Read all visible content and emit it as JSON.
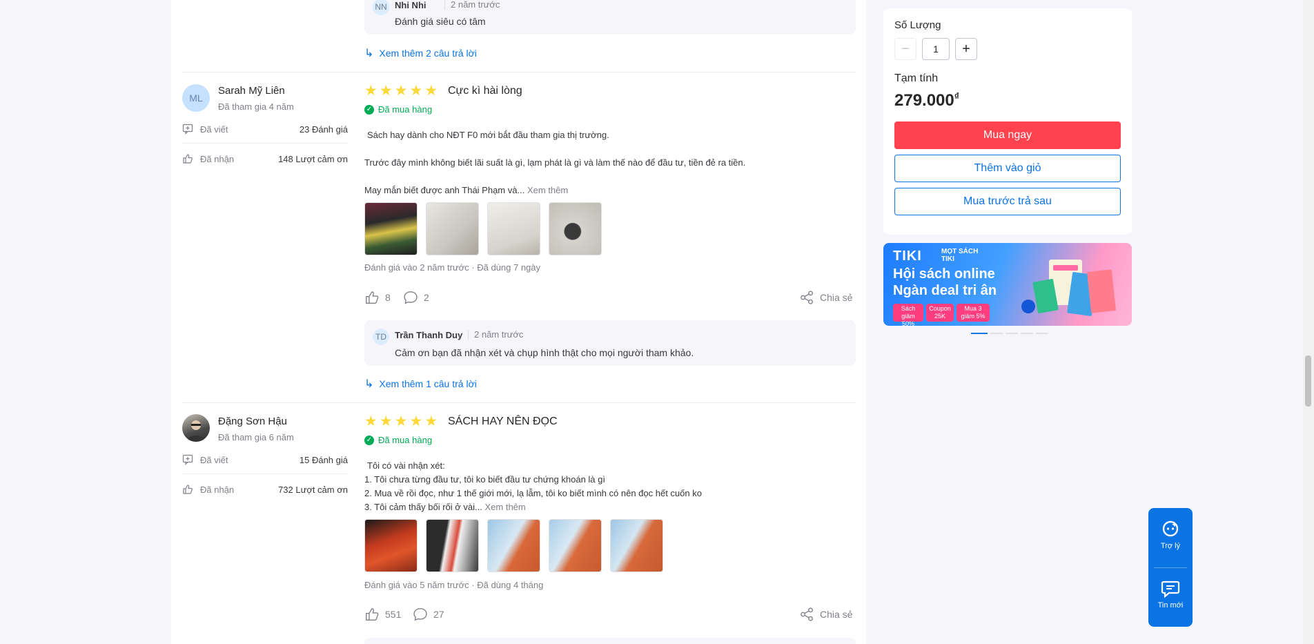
{
  "top_reply": {
    "avatar_initials": "NN",
    "name": "Nhi Nhi",
    "time": "2 năm trước",
    "text": "Đánh giá siêu có tâm",
    "more_replies": "Xem thêm 2 câu trả lời"
  },
  "reviews": [
    {
      "reviewer": {
        "avatar_initials": "ML",
        "name": "Sarah Mỹ Liên",
        "joined": "Đã tham gia 4 năm",
        "written_label": "Đã viết",
        "written_value": "23 Đánh giá",
        "received_label": "Đã nhận",
        "received_value": "148 Lượt cảm ơn"
      },
      "rating": 5,
      "title": "Cực kì hài lòng",
      "bought": "Đã mua hàng",
      "lines": [
        "Sách hay dành cho NĐT F0 mới bắt đầu tham gia thị trường.",
        "Trước đây mình không biết lãi suất là gì, lạm phát là gì và làm thế nào để đầu tư, tiền đẻ ra tiền.",
        "May mắn biết được anh Thái Phạm và..."
      ],
      "see_more": "Xem thêm",
      "meta_date": "Đánh giá vào 2 năm trước",
      "meta_used": "Đã dùng 7 ngày",
      "likes": "8",
      "comments": "2",
      "share": "Chia sẻ",
      "reply": {
        "avatar_initials": "TD",
        "name": "Trần Thanh Duy",
        "time": "2 năm trước",
        "text": "Cảm ơn bạn đã nhận xét và chụp hình thật cho mọi người tham khảo."
      },
      "more_replies": "Xem thêm 1 câu trả lời"
    },
    {
      "reviewer": {
        "name": "Đặng Sơn Hậu",
        "joined": "Đã tham gia 6 năm",
        "written_label": "Đã viết",
        "written_value": "15 Đánh giá",
        "received_label": "Đã nhận",
        "received_value": "732 Lượt cảm ơn"
      },
      "rating": 5,
      "title": "SÁCH HAY NÊN ĐỌC",
      "bought": "Đã mua hàng",
      "lines": [
        "Tôi có vài nhận xét:",
        "1. Tôi chưa từng đầu tư, tôi ko biết đầu tư chứng khoán là gì",
        "2. Mua về rồi đọc, như 1 thế giới mới, lạ lẫm, tôi ko biết mình có nên đọc hết cuốn ko",
        "3. Tôi cảm thấy bối rối ở vài..."
      ],
      "see_more": "Xem thêm",
      "meta_date": "Đánh giá vào 5 năm trước",
      "meta_used": "Đã dùng 4 tháng",
      "likes": "551",
      "comments": "27",
      "share": "Chia sẻ"
    }
  ],
  "purchase": {
    "qty_label": "Số Lượng",
    "qty_value": "1",
    "minus": "−",
    "plus": "+",
    "subtotal_label": "Tạm tính",
    "subtotal": "279.000",
    "currency": "₫",
    "buy_now": "Mua ngay",
    "add_cart": "Thêm vào giỏ",
    "bnpl": "Mua trước trả sau"
  },
  "banner": {
    "logo": "TIKI",
    "sub": "MỌT SÁCH TIKI",
    "title1": "Hội sách online",
    "title2": "Ngàn deal tri ân",
    "chips": [
      "Sách giảm 50%",
      "Coupon 25K",
      "Mua 3 giảm 5%"
    ]
  },
  "floating": {
    "assistant": "Trợ lý",
    "messages": "Tin mới"
  },
  "colors": {
    "accent": "#0b74e5",
    "buy": "#ff424e",
    "star": "#fdd836",
    "bought": "#00ab56"
  }
}
